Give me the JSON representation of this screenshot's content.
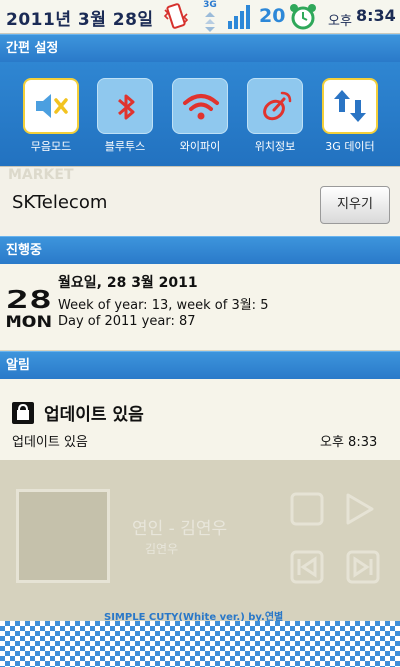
{
  "status_bar": {
    "date": "2011년 3월 28일",
    "network_type": "3G",
    "battery": "20",
    "ampm": "오후",
    "time": "8:34",
    "icons": [
      "phone-vibrate-icon",
      "3g-data-icon",
      "signal-icon",
      "alarm-clock-icon"
    ]
  },
  "quick_settings": {
    "header": "간편 설정",
    "toggles": [
      {
        "label": "무음모드",
        "icon": "speaker-mute-icon"
      },
      {
        "label": "블루투스",
        "icon": "bluetooth-icon"
      },
      {
        "label": "와이파이",
        "icon": "wifi-icon"
      },
      {
        "label": "위치정보",
        "icon": "location-satellite-icon"
      },
      {
        "label": "3G 데이터",
        "icon": "data-arrows-icon"
      }
    ]
  },
  "carrier": {
    "background_text": "MARKET",
    "name": "SKTelecom",
    "clear_label": "지우기"
  },
  "ongoing": {
    "header": "진행중",
    "icon_day": "28",
    "icon_weekday": "MON",
    "title": "월요일, 28 3월 2011",
    "line1": "Week of year: 13, week of 3월: 5",
    "line2": "Day of 2011 year: 87"
  },
  "notifications": {
    "header": "알림",
    "title": "업데이트 있음",
    "text": "업데이트 있음",
    "time": "오후 8:33"
  },
  "background_widget": {
    "song_title": "연인 - 김연우",
    "artist": "김연우",
    "credit": "SIMPLE CUTY(White ver.) by.연별"
  },
  "colors": {
    "accent_blue": "#2a7ac9",
    "toggle_active_border": "#f3cf3a",
    "panel_bg": "#f6f4ea"
  }
}
